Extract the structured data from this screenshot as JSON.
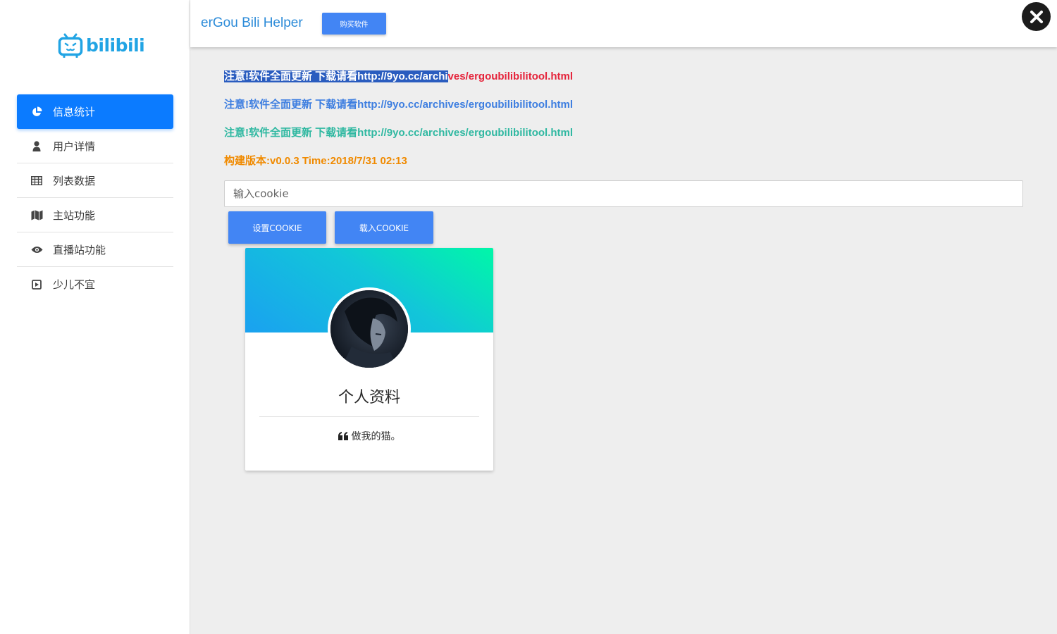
{
  "sidebar": {
    "logo_text": "bilibili",
    "items": [
      {
        "label": "信息统计",
        "icon": "pie-chart-icon",
        "active": true
      },
      {
        "label": "用户详情",
        "icon": "user-icon"
      },
      {
        "label": "列表数据",
        "icon": "table-icon"
      },
      {
        "label": "主站功能",
        "icon": "map-icon"
      },
      {
        "label": "直播站功能",
        "icon": "eye-icon"
      },
      {
        "label": "少儿不宜",
        "icon": "play-square-icon"
      }
    ]
  },
  "header": {
    "title": "erGou Bili Helper",
    "buy_button": "购买软件"
  },
  "notices": {
    "line1_selected": "注意!软件全面更新 下载请看http://9yo.cc/archi",
    "line1_rest": "ves/ergoubilibilitool.html",
    "line2": "注意!软件全面更新 下载请看http://9yo.cc/archives/ergoubilibilitool.html",
    "line3": "注意!软件全面更新 下载请看http://9yo.cc/archives/ergoubilibilitool.html",
    "build": "构建版本:v0.0.3 Time:2018/7/31 02:13"
  },
  "cookie": {
    "placeholder": "输入cookie",
    "set_button": "设置COOKIE",
    "load_button": "载入COOKIE"
  },
  "profile": {
    "title": "个人资料",
    "quote": "做我的猫。"
  },
  "colors": {
    "accent": "#4285f4",
    "nav_active": "#0b7bff",
    "notice_red": "#e5243b",
    "notice_blue": "#3d7ee0",
    "notice_teal": "#2fb8a1",
    "notice_orange": "#f08a00",
    "brand": "#21a4e4"
  }
}
